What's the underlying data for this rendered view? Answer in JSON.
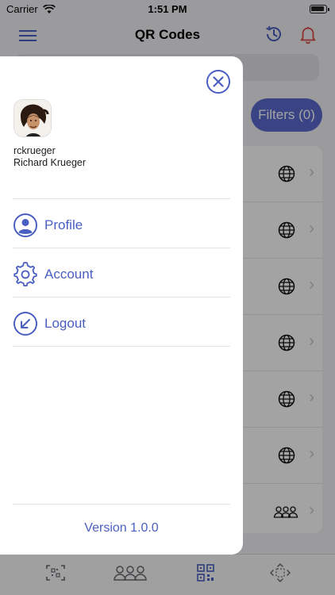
{
  "status_bar": {
    "carrier": "Carrier",
    "time": "1:51 PM"
  },
  "navbar": {
    "title": "QR Codes"
  },
  "filters": {
    "label": "Filters (0)"
  },
  "list_rows": [
    "globe-icon",
    "globe-icon",
    "globe-icon",
    "globe-icon",
    "globe-icon",
    "globe-icon",
    "group-icon"
  ],
  "drawer": {
    "username": "rckrueger",
    "full_name": "Richard Krueger",
    "menu": {
      "profile": "Profile",
      "account": "Account",
      "logout": "Logout"
    },
    "version": "Version 1.0.0"
  },
  "colors": {
    "accent": "#4a5fc1",
    "filters_bg": "#5b6bd0",
    "alert": "#e04848"
  }
}
